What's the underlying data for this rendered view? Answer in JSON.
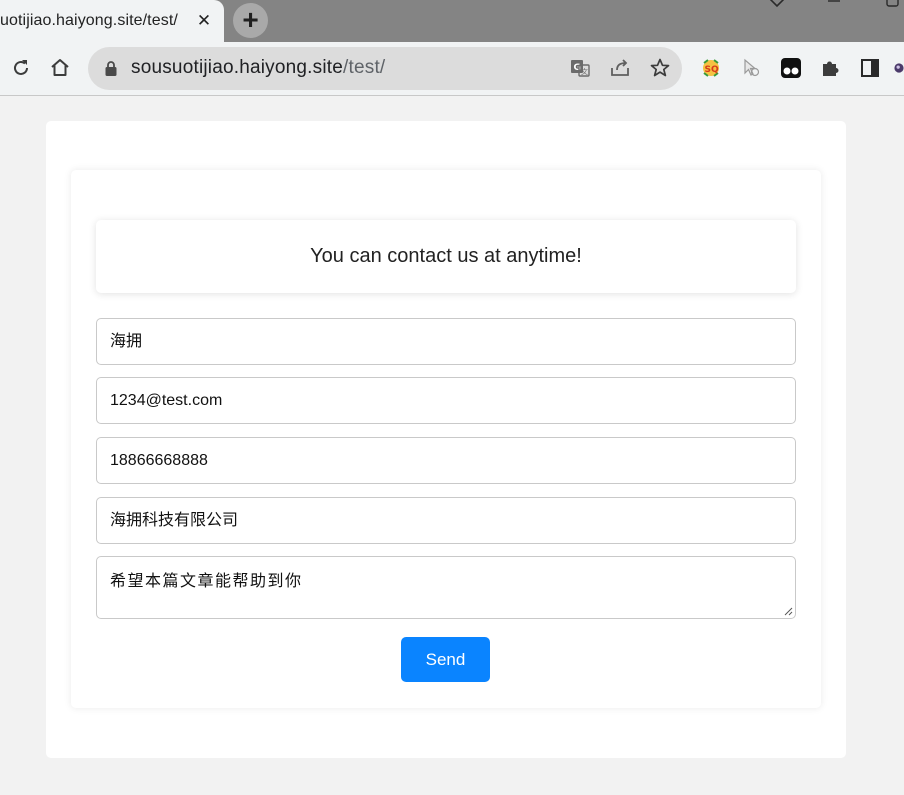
{
  "tab": {
    "title": "uotijiao.haiyong.site/test/",
    "close_glyph": "✕",
    "new_tab_glyph": "+"
  },
  "toolbar": {
    "url_host": "sousuotijiao.haiyong.site",
    "url_path": "/test/",
    "icons": [
      "reload-icon",
      "home-icon",
      "lock-icon",
      "translate-icon",
      "share-icon",
      "bookmark-star-icon",
      "extension-sq-icon",
      "extension-cursor-icon",
      "extension-tampermonkey-icon",
      "extensions-puzzle-icon",
      "side-panel-icon",
      "profile-avatar-icon"
    ]
  },
  "form": {
    "heading": "You can contact us at anytime!",
    "name_value": "海拥",
    "email_value": "1234@test.com",
    "phone_value": "18866668888",
    "company_value": "海拥科技有限公司",
    "message_value": "希望本篇文章能帮助到你",
    "send_label": "Send"
  },
  "colors": {
    "accent": "#0a84ff",
    "page_bg": "#f2f2f2",
    "tabstrip": "#848484"
  }
}
